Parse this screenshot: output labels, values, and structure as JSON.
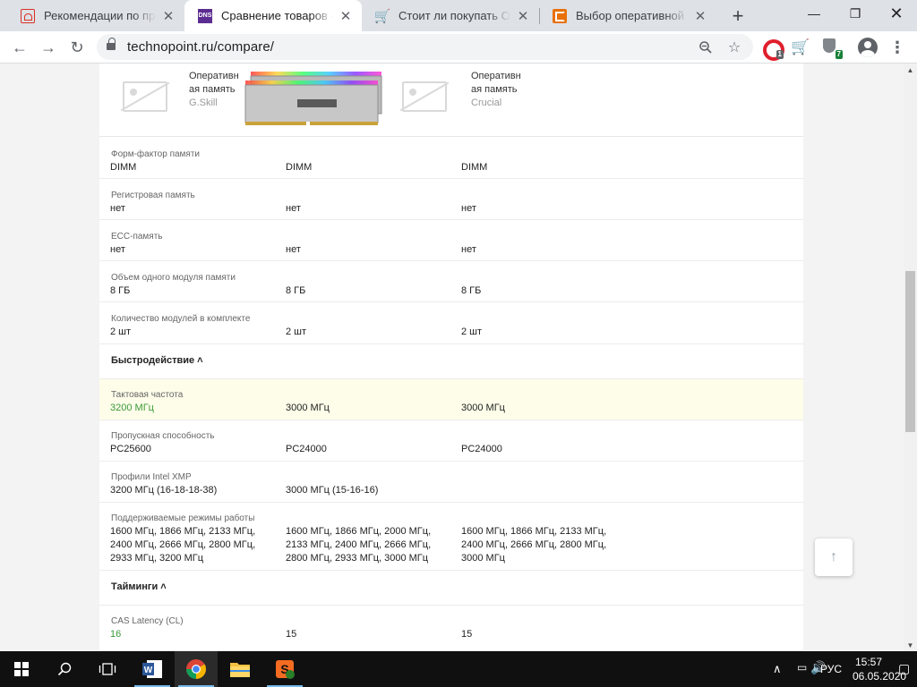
{
  "browser": {
    "tabs": [
      {
        "title": "Рекомендации по проф",
        "icon": "pdf-icon"
      },
      {
        "title": "Сравнение товаров - Te",
        "icon": "dns-icon"
      },
      {
        "title": "Стоит ли покупать Опер",
        "icon": "cart-icon"
      },
      {
        "title": "Выбор оперативной пам",
        "icon": "c-icon"
      }
    ],
    "active_tab": 1,
    "url": "technopoint.ru/compare/",
    "extensions": {
      "opera_badge": "1",
      "shield_badge": "7"
    },
    "dns_favicon_text": "DNS"
  },
  "products": [
    {
      "name": "Оперативн ая память",
      "brand": "G.Skill"
    },
    {
      "name": "",
      "brand": ""
    },
    {
      "name": "Оперативн ая память",
      "brand": "Crucial"
    }
  ],
  "specs_general": [
    {
      "label": "Форм-фактор памяти",
      "values": [
        "DIMM",
        "DIMM",
        "DIMM"
      ]
    },
    {
      "label": "Регистровая память",
      "values": [
        "нет",
        "нет",
        "нет"
      ]
    },
    {
      "label": "ECC-память",
      "values": [
        "нет",
        "нет",
        "нет"
      ]
    },
    {
      "label": "Объем одного модуля памяти",
      "values": [
        "8 ГБ",
        "8 ГБ",
        "8 ГБ"
      ]
    },
    {
      "label": "Количество модулей в комплекте",
      "values": [
        "2 шт",
        "2 шт",
        "2 шт"
      ]
    }
  ],
  "section_performance": "Быстродействие",
  "specs_performance": [
    {
      "label": "Тактовая частота",
      "values": [
        "3200 МГц",
        "3000 МГц",
        "3000 МГц"
      ],
      "highlight": true
    },
    {
      "label": "Пропускная способность",
      "values": [
        "PC25600",
        "PC24000",
        "PC24000"
      ]
    },
    {
      "label": "Профили Intel XMP",
      "values": [
        "3200 МГц (16-18-18-38)",
        "3000 МГц (15-16-16)",
        ""
      ]
    },
    {
      "label": "Поддерживаемые режимы работы",
      "values": [
        "1600 МГц, 1866 МГц, 2133 МГц, 2400 МГц, 2666 МГц, 2800 МГц, 2933 МГц, 3200 МГц",
        "1600 МГц, 1866 МГц, 2000 МГц, 2133 МГц, 2400 МГц, 2666 МГц, 2800 МГц, 2933 МГц, 3000 МГц",
        "1600 МГц, 1866 МГц, 2133 МГц, 2400 МГц, 2666 МГц, 2800 МГц, 3000 МГц"
      ]
    }
  ],
  "section_timings": "Тайминги",
  "specs_timings": [
    {
      "label": "CAS Latency (CL)",
      "values": [
        "16",
        "15",
        "15"
      ]
    }
  ],
  "collapse_glyph": "˄",
  "taskbar": {
    "language": "РУС",
    "time": "15:57",
    "date": "06.05.2020"
  },
  "colors": {
    "best_value": "#3a9a3a",
    "highlight_row": "#fdfde9"
  }
}
